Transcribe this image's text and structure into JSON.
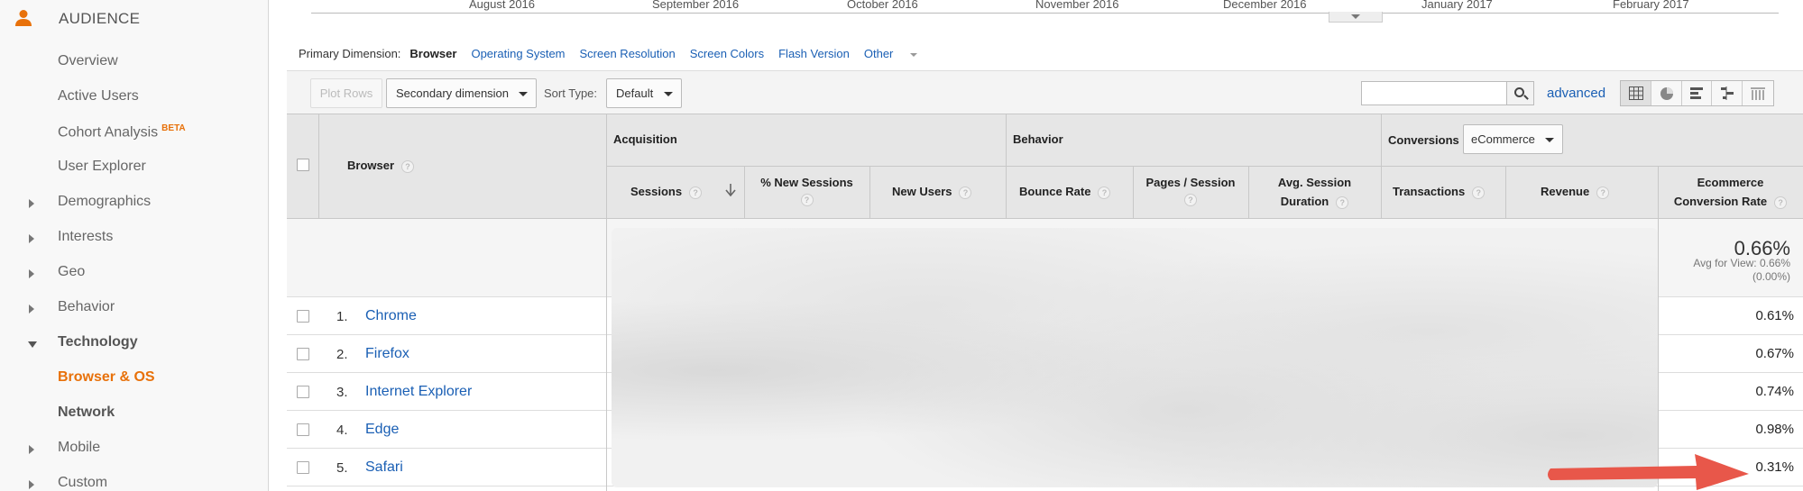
{
  "sidebar": {
    "section": "AUDIENCE",
    "items": [
      {
        "label": "Overview",
        "type": "sub"
      },
      {
        "label": "Active Users",
        "type": "sub"
      },
      {
        "label": "Cohort Analysis",
        "badge": "BETA",
        "type": "sub"
      },
      {
        "label": "User Explorer",
        "type": "sub"
      },
      {
        "label": "Demographics",
        "type": "collapsed"
      },
      {
        "label": "Interests",
        "type": "collapsed"
      },
      {
        "label": "Geo",
        "type": "collapsed"
      },
      {
        "label": "Behavior",
        "type": "collapsed"
      },
      {
        "label": "Technology",
        "type": "expanded"
      },
      {
        "label": "Browser & OS",
        "type": "active"
      },
      {
        "label": "Network",
        "type": "bold"
      },
      {
        "label": "Mobile",
        "type": "collapsed"
      },
      {
        "label": "Custom",
        "type": "collapsed"
      }
    ]
  },
  "timeline": {
    "months": [
      "August 2016",
      "September 2016",
      "October 2016",
      "November 2016",
      "December 2016",
      "January 2017",
      "February 2017"
    ]
  },
  "primary_dimension": {
    "label": "Primary Dimension:",
    "active": "Browser",
    "links": [
      "Operating System",
      "Screen Resolution",
      "Screen Colors",
      "Flash Version"
    ],
    "other": "Other"
  },
  "toolbar": {
    "plot_rows": "Plot Rows",
    "secondary_dimension": "Secondary dimension",
    "sort_type_label": "Sort Type:",
    "sort_type_value": "Default",
    "search_value": "",
    "advanced": "advanced"
  },
  "table": {
    "col_browser": "Browser",
    "group_acquisition": "Acquisition",
    "group_behavior": "Behavior",
    "group_conversions": "Conversions",
    "conversions_select": "eCommerce",
    "col_sessions": "Sessions",
    "col_new_sessions": "% New Sessions",
    "col_new_users": "New Users",
    "col_bounce_rate": "Bounce Rate",
    "col_pages_session_1": "Pages / Session",
    "col_avg_session_1": "Avg. Session",
    "col_avg_session_2": "Duration",
    "col_transactions": "Transactions",
    "col_revenue": "Revenue",
    "col_ecom_1": "Ecommerce",
    "col_ecom_2": "Conversion Rate",
    "help": "?",
    "total": {
      "value": "0.66%",
      "avg_line1": "Avg for View: 0.66%",
      "avg_line2": "(0.00%)"
    },
    "rows": [
      {
        "num": "1.",
        "name": "Chrome",
        "rate": "0.61%"
      },
      {
        "num": "2.",
        "name": "Firefox",
        "rate": "0.67%"
      },
      {
        "num": "3.",
        "name": "Internet Explorer",
        "rate": "0.74%"
      },
      {
        "num": "4.",
        "name": "Edge",
        "rate": "0.98%"
      },
      {
        "num": "5.",
        "name": "Safari",
        "rate": "0.31%"
      }
    ]
  },
  "colors": {
    "accent_orange": "#e8710a",
    "link_blue": "#1a5fb4",
    "arrow_red": "#e8574a"
  }
}
